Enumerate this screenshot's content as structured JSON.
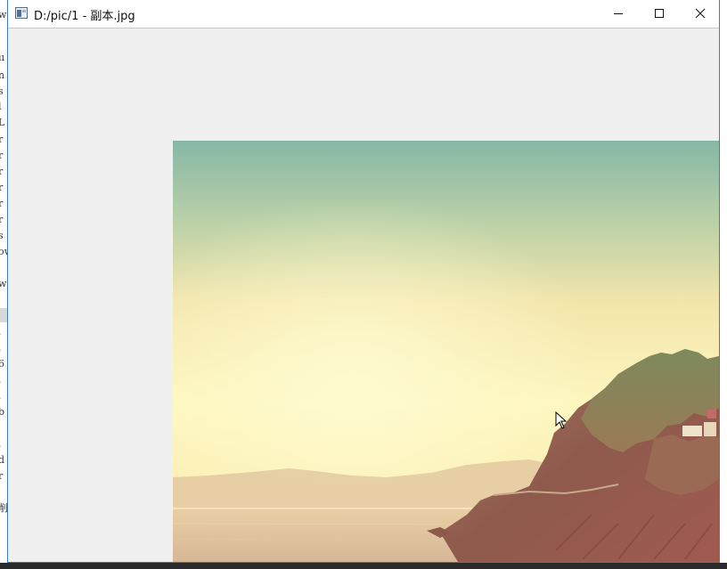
{
  "window": {
    "title": "D:/pic/1 - 副本.jpg",
    "controls": [
      "minimize",
      "maximize",
      "close"
    ]
  },
  "background_editor": {
    "fragments": [
      "w",
      "ıı",
      "n",
      "s",
      "l",
      "L",
      "r",
      "r",
      "r",
      "r",
      "r",
      "r",
      "s",
      "ow",
      "w",
      ".",
      ".",
      "6",
      ".",
      ".",
      "b",
      ".",
      "d",
      "r",
      "削"
    ]
  },
  "image": {
    "subject": "sunset coastal cliffs",
    "icon": "photo-content"
  },
  "colors": {
    "window_border": "#3a7bd5",
    "canvas_bg": "#f0f0f0",
    "titlebar_bg": "#ffffff"
  }
}
